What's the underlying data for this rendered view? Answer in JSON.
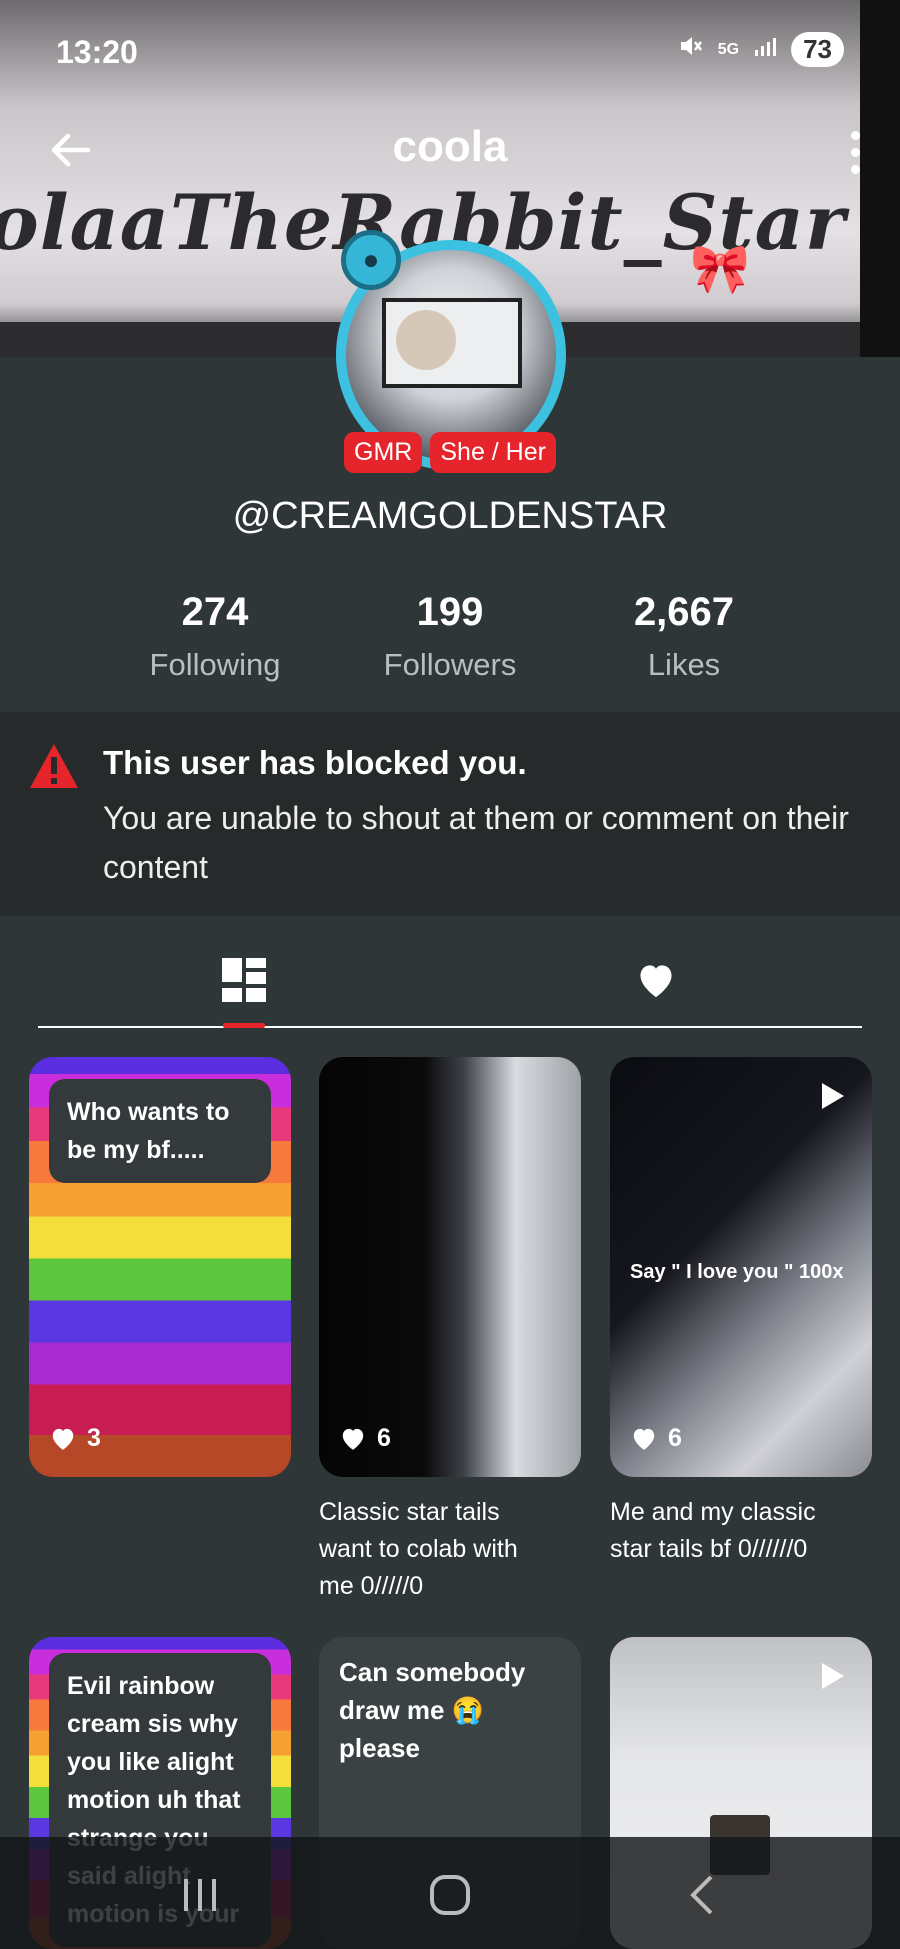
{
  "status_bar": {
    "time": "13:20",
    "network": "5G",
    "battery": "73"
  },
  "header": {
    "title": "coola"
  },
  "banner": {
    "text": "olaaTheRabbit_Star"
  },
  "profile": {
    "tags": [
      "GMR",
      "She / Her"
    ],
    "handle": "@CREAMGOLDENSTAR",
    "stats": [
      {
        "value": "274",
        "label": "Following"
      },
      {
        "value": "199",
        "label": "Followers"
      },
      {
        "value": "2,667",
        "label": "Likes"
      }
    ]
  },
  "blocked_notice": {
    "title": "This user has blocked you.",
    "message": "You are unable to shout at them or comment on their content"
  },
  "tabs": [
    {
      "icon": "grid-posts-icon",
      "selected": true
    },
    {
      "icon": "heart-icon",
      "selected": false
    }
  ],
  "posts": [
    {
      "text": "Who wants to be my bf.....",
      "likes": "3"
    },
    {
      "likes": "6",
      "caption_line1": "Classic star tails",
      "caption_line2": "want to colab with",
      "caption_line3": "me      0/////0"
    },
    {
      "likes": "6",
      "overlay": "Say \" I love you \" 100x",
      "caption_line1": "Me and my classic",
      "caption_line2": "star tails bf 0//////0"
    },
    {
      "text": "Evil rainbow cream sis why you like alight motion uh that strange you said alight motion is your"
    },
    {
      "text": "Can somebody draw me 😭 please"
    },
    {
      "media": "video"
    }
  ],
  "colors": {
    "accent": "#e5242b",
    "background": "#2f3637",
    "notice_bg": "#262a2b",
    "avatar_ring": "#3cc2e0"
  }
}
